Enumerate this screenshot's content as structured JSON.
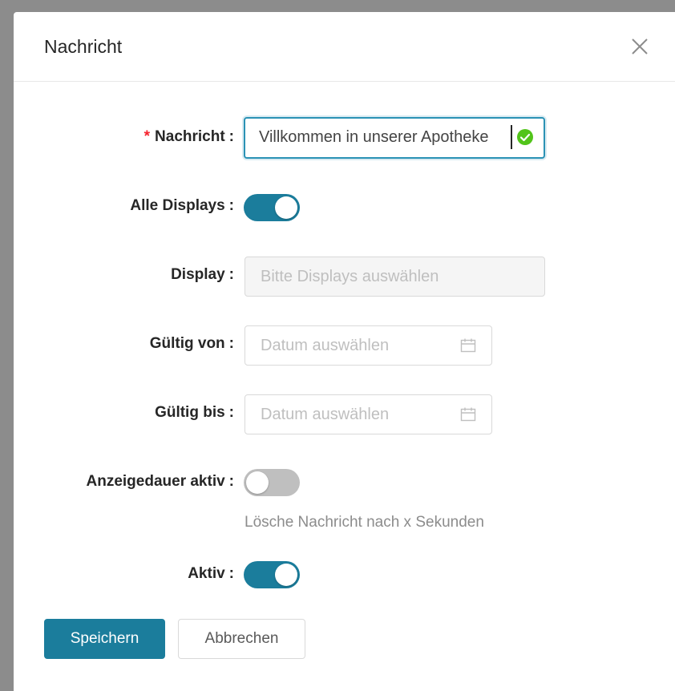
{
  "modal": {
    "title": "Nachricht",
    "close_icon": "close-icon"
  },
  "form": {
    "message": {
      "label": "Nachricht",
      "required_mark": "*",
      "value": "Villkommen in unserer Apotheke",
      "status_icon": "check-circle-icon"
    },
    "all_displays": {
      "label": "Alle Displays",
      "checked": true
    },
    "display": {
      "label": "Display",
      "placeholder": "Bitte Displays auswählen",
      "disabled": true
    },
    "valid_from": {
      "label": "Gültig von",
      "placeholder": "Datum auswählen",
      "icon": "calendar-icon"
    },
    "valid_to": {
      "label": "Gültig bis",
      "placeholder": "Datum auswählen",
      "icon": "calendar-icon"
    },
    "duration_active": {
      "label": "Anzeigedauer aktiv",
      "checked": false,
      "hint": "Lösche Nachricht nach x Sekunden"
    },
    "active": {
      "label": "Aktiv",
      "checked": true
    },
    "colon": ":"
  },
  "buttons": {
    "save": "Speichern",
    "cancel": "Abbrechen"
  },
  "colors": {
    "primary": "#1b7d9c",
    "required": "#f5222d",
    "success": "#52c41a"
  }
}
